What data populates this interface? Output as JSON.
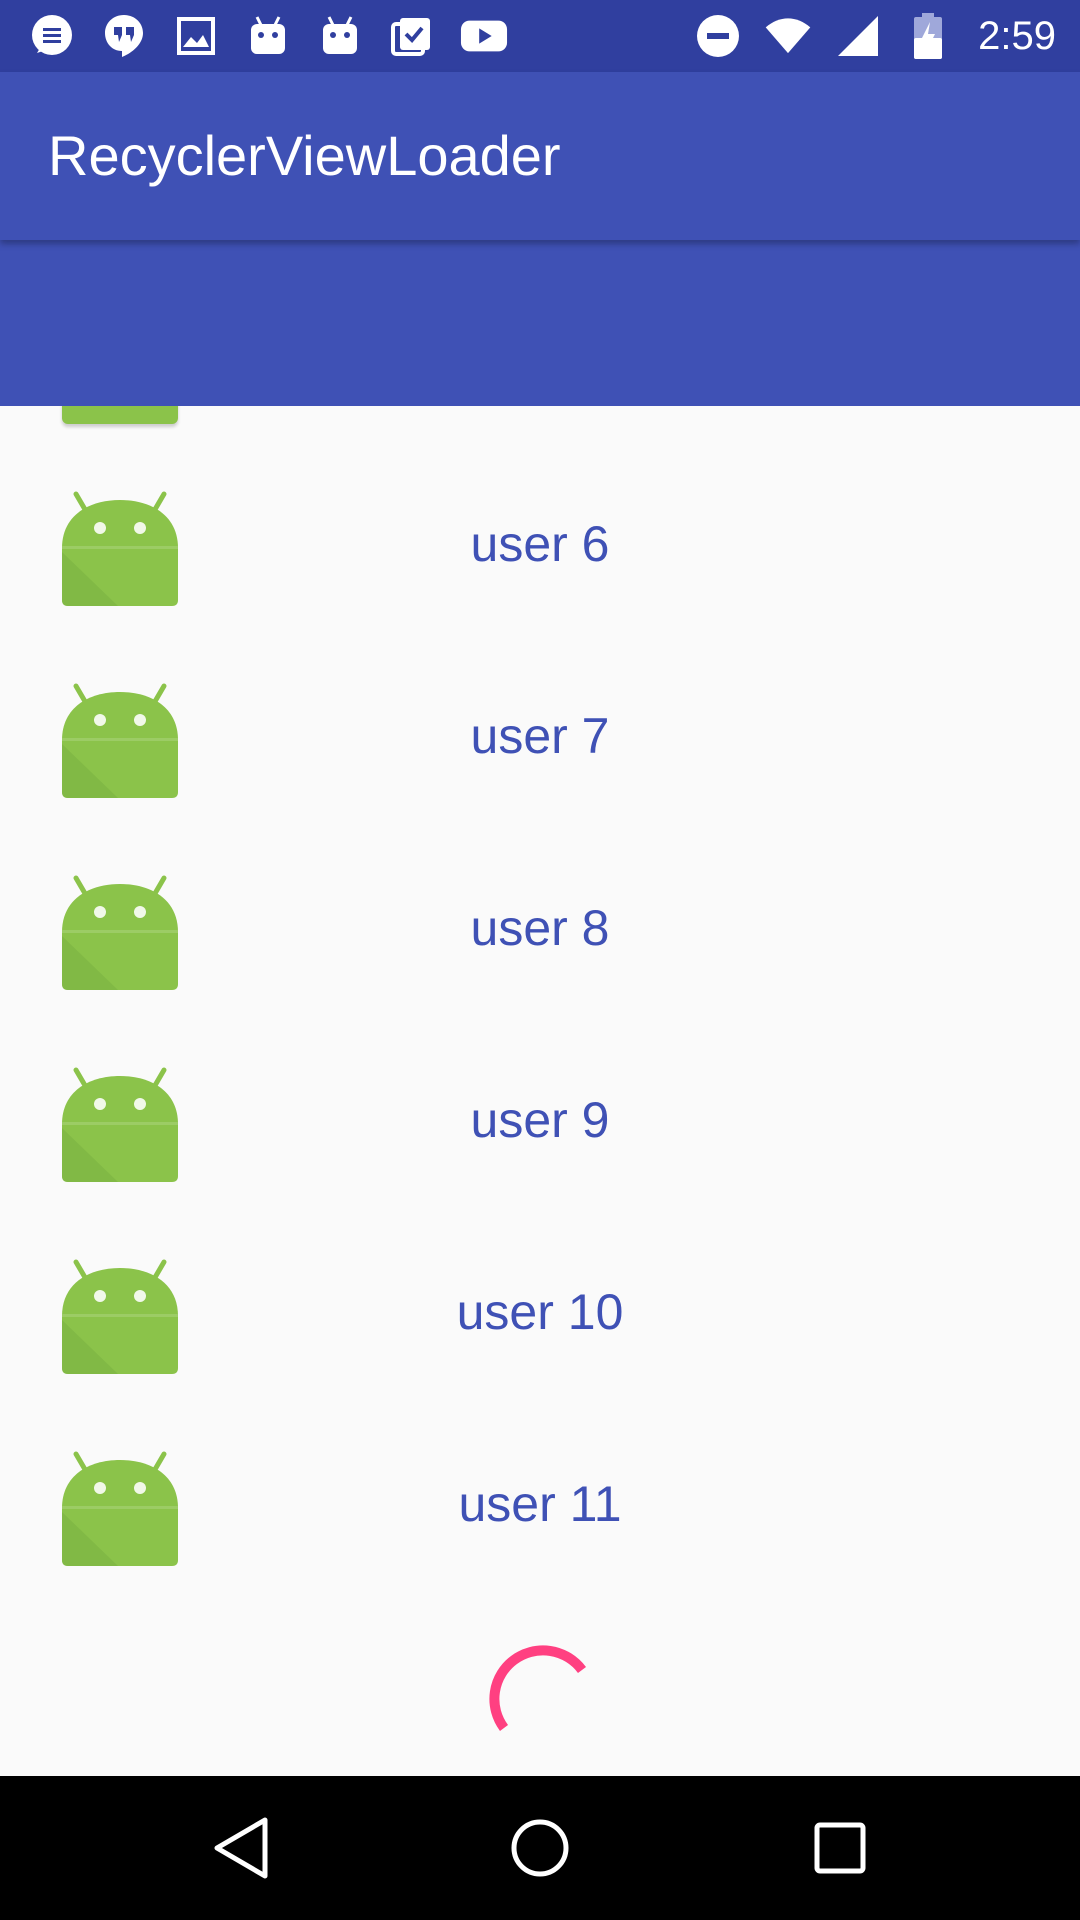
{
  "status_bar": {
    "time": "2:59",
    "left_icons": [
      "messages-icon",
      "hangouts-icon",
      "gallery-icon",
      "android-notification-icon",
      "android-notification-icon",
      "clipboard-check-icon",
      "youtube-icon"
    ],
    "right_icons": [
      "do-not-disturb-icon",
      "wifi-icon",
      "cell-signal-icon",
      "battery-charging-icon"
    ]
  },
  "app_bar": {
    "title": "RecyclerViewLoader"
  },
  "list": {
    "items": [
      {
        "label": "user 6",
        "icon": "android-avatar-icon"
      },
      {
        "label": "user 7",
        "icon": "android-avatar-icon"
      },
      {
        "label": "user 8",
        "icon": "android-avatar-icon"
      },
      {
        "label": "user 9",
        "icon": "android-avatar-icon"
      },
      {
        "label": "user 10",
        "icon": "android-avatar-icon"
      },
      {
        "label": "user 11",
        "icon": "android-avatar-icon"
      }
    ],
    "loading": true
  },
  "nav_bar": {
    "buttons": [
      "back-icon",
      "home-icon",
      "recents-icon"
    ]
  },
  "colors": {
    "status_bar": "#303f9f",
    "primary": "#3f51b5",
    "list_text": "#3f51b5",
    "android_green": "#8bc34a",
    "spinner": "#ff4081",
    "background": "#fafafa"
  }
}
